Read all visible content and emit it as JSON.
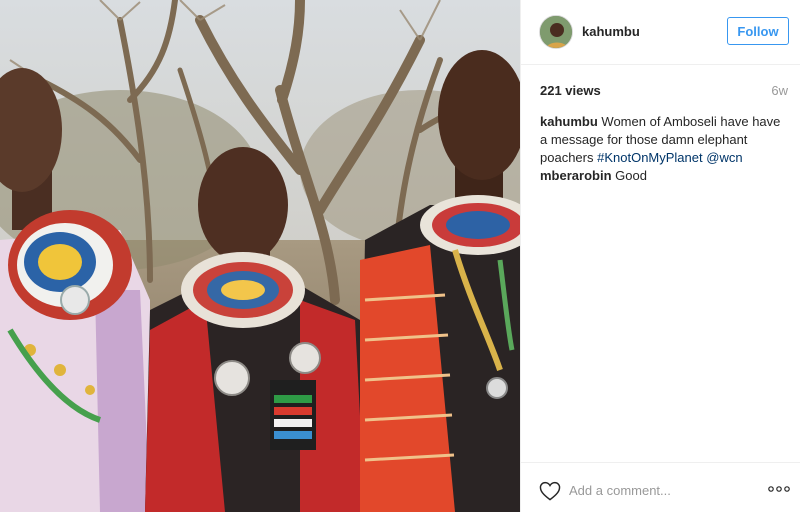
{
  "post": {
    "image_description": "Photo of Maasai women wearing beaded collars under acacia trees",
    "username": "kahumbu",
    "follow_label": "Follow",
    "views": "221 views",
    "age": "6w"
  },
  "comments": [
    {
      "user": "kahumbu",
      "text": "Women of Amboseli have have a message for those damn elephant poachers",
      "hashtag": "#KnotOnMyPlanet",
      "mention": "@wcn"
    },
    {
      "user": "mberarobin",
      "text": "Good"
    }
  ],
  "footer": {
    "comment_placeholder": "Add a comment...",
    "like_icon": "heart-outline-icon",
    "more_icon": "ellipsis-icon"
  },
  "colors": {
    "accent": "#3897f0",
    "hashtag": "#003569",
    "muted": "#999999",
    "border": "#efefef"
  }
}
